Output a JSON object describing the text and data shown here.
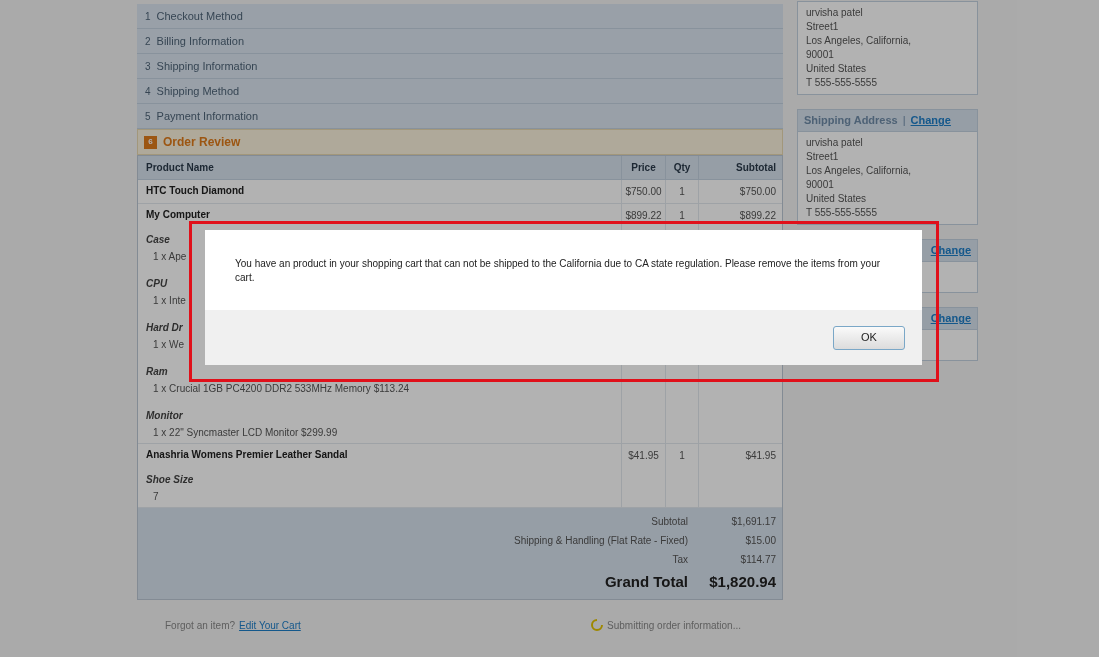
{
  "checkout_steps": [
    {
      "number": "1",
      "label": "Checkout Method",
      "active": false
    },
    {
      "number": "2",
      "label": "Billing Information",
      "active": false
    },
    {
      "number": "3",
      "label": "Shipping Information",
      "active": false
    },
    {
      "number": "4",
      "label": "Shipping Method",
      "active": false
    },
    {
      "number": "5",
      "label": "Payment Information",
      "active": false
    },
    {
      "number": "6",
      "label": "Order Review",
      "active": true
    }
  ],
  "order_review": {
    "columns": [
      "Product Name",
      "Price",
      "Qty",
      "Subtotal"
    ],
    "items": [
      {
        "name": "HTC Touch Diamond",
        "price": "$750.00",
        "qty": "1",
        "subtotal": "$750.00"
      },
      {
        "name": "My Computer",
        "price": "$899.22",
        "qty": "1",
        "subtotal": "$899.22",
        "options": [
          {
            "label": "Case",
            "value": "1 x Ape"
          },
          {
            "label": "CPU",
            "value": "1 x Inte"
          },
          {
            "label": "Hard Dr",
            "value": "1 x We"
          },
          {
            "label": "Ram",
            "value": "1 x Crucial 1GB PC4200 DDR2 533MHz Memory $113.24"
          },
          {
            "label": "Monitor",
            "value": "1 x 22\" Syncmaster LCD Monitor $299.99"
          }
        ]
      },
      {
        "name": "Anashria Womens Premier Leather Sandal",
        "price": "$41.95",
        "qty": "1",
        "subtotal": "$41.95",
        "options": [
          {
            "label": "Shoe Size",
            "value": "7"
          }
        ]
      }
    ],
    "totals": [
      {
        "label": "Subtotal",
        "value": "$1,691.17",
        "kind": "normal"
      },
      {
        "label": "Shipping & Handling (Flat Rate - Fixed)",
        "value": "$15.00",
        "kind": "normal"
      },
      {
        "label": "Tax",
        "value": "$114.77",
        "kind": "normal"
      },
      {
        "label": "Grand Total",
        "value": "$1,820.94",
        "kind": "grand"
      }
    ]
  },
  "footer": {
    "question": "Forgot an item?",
    "link": "Edit Your Cart",
    "status": "Submitting order information..."
  },
  "sidebar": [
    {
      "lines": [
        "urvisha patel",
        "Street1",
        "Los Angeles, California,",
        "90001",
        "United States",
        "T 555-555-5555"
      ]
    },
    {
      "header": "Shipping Address",
      "separator": "|",
      "change_link": "Change",
      "lines": [
        "urvisha patel",
        "Street1",
        "Los Angeles, California,",
        "90001",
        "United States",
        "T 555-555-5555"
      ]
    },
    {
      "change_link": "Change"
    },
    {
      "change_link": "Change"
    }
  ],
  "dialog": {
    "message": "You have an product in your shopping cart that can not be shipped to the California due to CA state regulation. Please remove the items from your cart.",
    "button": "OK"
  }
}
